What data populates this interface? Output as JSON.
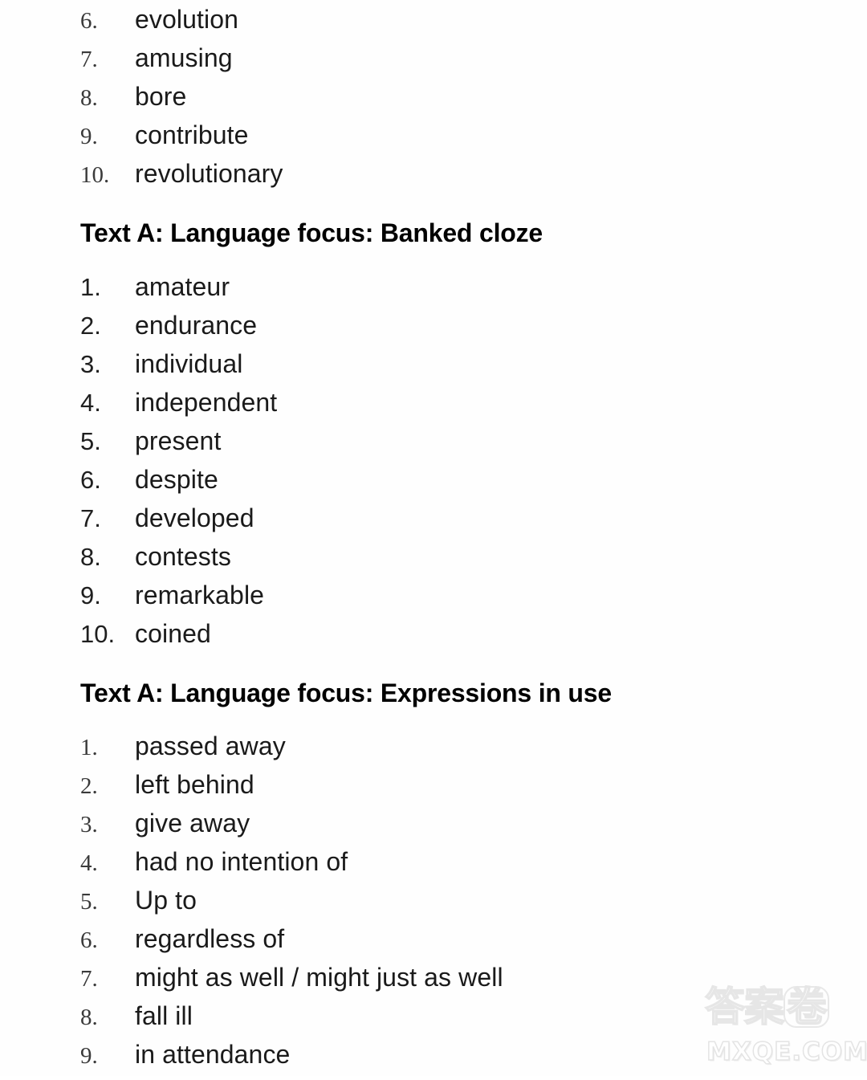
{
  "document": {
    "type": "answer-key-page",
    "background_color": "#fefefe",
    "text_color": "#1a1a1a"
  },
  "sections": [
    {
      "id": "continued-word-list",
      "heading": null,
      "number_style": "serif",
      "items": [
        {
          "number": "6.",
          "text": "evolution"
        },
        {
          "number": "7.",
          "text": "amusing"
        },
        {
          "number": "8.",
          "text": "bore"
        },
        {
          "number": "9.",
          "text": "contribute"
        },
        {
          "number": "10.",
          "text": "revolutionary"
        }
      ]
    },
    {
      "id": "banked-cloze",
      "heading": "Text A: Language focus: Banked cloze",
      "number_style": "sans",
      "items": [
        {
          "number": "1.",
          "text": "amateur"
        },
        {
          "number": "2.",
          "text": "endurance"
        },
        {
          "number": "3.",
          "text": "individual"
        },
        {
          "number": "4.",
          "text": "independent"
        },
        {
          "number": "5.",
          "text": "present"
        },
        {
          "number": "6.",
          "text": "despite"
        },
        {
          "number": "7.",
          "text": "developed"
        },
        {
          "number": "8.",
          "text": "contests"
        },
        {
          "number": "9.",
          "text": "remarkable"
        },
        {
          "number": "10.",
          "text": "coined"
        }
      ]
    },
    {
      "id": "expressions-in-use",
      "heading": "Text A: Language focus: Expressions in use",
      "number_style": "serif",
      "items": [
        {
          "number": "1.",
          "text": "passed away"
        },
        {
          "number": "2.",
          "text": "left behind"
        },
        {
          "number": "3.",
          "text": "give away"
        },
        {
          "number": "4.",
          "text": "had no intention of"
        },
        {
          "number": "5.",
          "text": "Up to"
        },
        {
          "number": "6.",
          "text": "regardless of"
        },
        {
          "number": "7.",
          "text": "might as well / might just as well"
        },
        {
          "number": "8.",
          "text": "fall ill"
        },
        {
          "number": "9.",
          "text": "in attendance"
        }
      ]
    }
  ],
  "watermark": {
    "chinese_text": "答案",
    "chinese_boxed_char": "卷",
    "domain_text": "MXQE.COM",
    "color": "#e8e8e8"
  }
}
